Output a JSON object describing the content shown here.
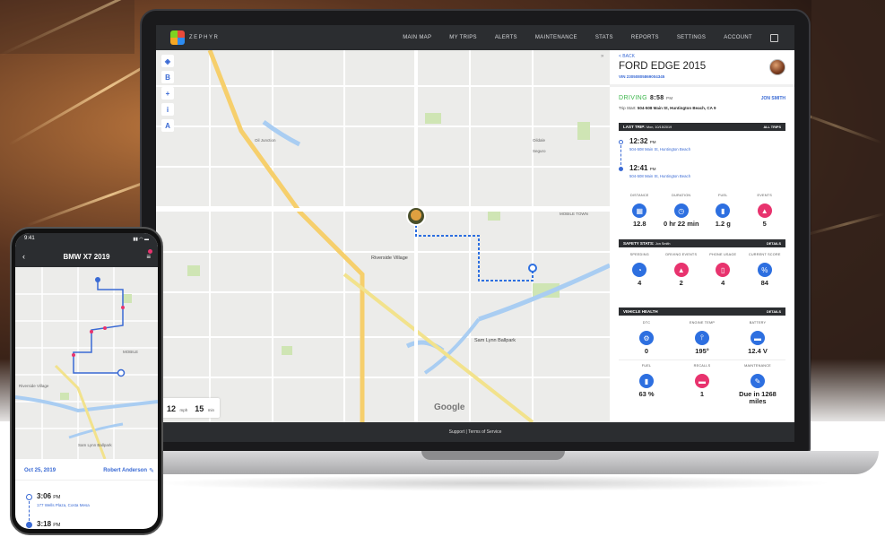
{
  "nav": {
    "logo": "ZEPHYR",
    "items": [
      "MAIN MAP",
      "MY TRIPS",
      "ALERTS",
      "MAINTENANCE",
      "STATS",
      "REPORTS",
      "SETTINGS",
      "ACCOUNT"
    ]
  },
  "map": {
    "tools": [
      "B",
      "+",
      "A"
    ],
    "speed_value": "12",
    "speed_unit": "mph",
    "time_value": "15",
    "time_unit": "min",
    "provider": "Google",
    "labels": {
      "riverside": "Riverside Village",
      "ballpark": "Sam Lynn Ballpark",
      "mobile_town": "MOBILE TOWN",
      "junction": "Oil Junction",
      "oildale": "Oildale",
      "seguro": "Seguro"
    }
  },
  "panel": {
    "back": "< BACK",
    "title": "FORD EDGE 2015",
    "vin": "VIN 23050805869004345",
    "status": "DRIVING",
    "status_time": "8:58",
    "status_ampm": "PM",
    "driver": "JON SMITH",
    "trip_start_label": "Trip Start:",
    "trip_start_addr": "504-508 Main St, Huntington Beach, CA 9",
    "last_trip": {
      "title": "LAST TRIP:",
      "date": "Mon, 10/15/2019",
      "action": "ALL TRIPS",
      "stops": [
        {
          "time": "12:32",
          "ampm": "PM",
          "addr": "504-508 Main St, Huntington Beach"
        },
        {
          "time": "12:41",
          "ampm": "PM",
          "addr": "504-508 Main St, Huntington Beach"
        }
      ]
    },
    "trip_stats": [
      {
        "label": "DISTANCE",
        "value": "12.8",
        "icon": "odometer-icon",
        "glyph": "▦"
      },
      {
        "label": "DURATION",
        "value": "0 hr 22 min",
        "icon": "clock-icon",
        "glyph": "◷"
      },
      {
        "label": "FUEL",
        "value": "1.2 g",
        "icon": "fuel-icon",
        "glyph": "▮"
      },
      {
        "label": "EVENTS",
        "value": "5",
        "icon": "warning-icon",
        "glyph": "▲"
      }
    ],
    "safety": {
      "title": "SAFETY STATS:",
      "driver": "Jon Smith",
      "action": "DETAILS",
      "items": [
        {
          "label": "SPEEDING",
          "value": "4",
          "icon": "speedometer-icon",
          "glyph": "◔"
        },
        {
          "label": "DRIVING EVENTS",
          "value": "2",
          "icon": "warning-icon",
          "glyph": "▲"
        },
        {
          "label": "PHONE USAGE",
          "value": "4",
          "icon": "phone-icon",
          "glyph": "▯"
        },
        {
          "label": "CURRENT SCORE",
          "value": "84",
          "icon": "percent-icon",
          "glyph": "%"
        }
      ]
    },
    "health": {
      "title": "VEHICLE HEALTH",
      "action": "DETAILS",
      "items": [
        {
          "label": "DTC",
          "value": "0",
          "icon": "engine-icon",
          "glyph": "⚙"
        },
        {
          "label": "ENGINE TEMP",
          "value": "195°",
          "icon": "thermometer-icon",
          "glyph": "⫯"
        },
        {
          "label": "BATTERY",
          "value": "12.4 V",
          "icon": "battery-icon",
          "glyph": "▬"
        },
        {
          "label": "FUEL",
          "value": "63 %",
          "icon": "fuel-icon",
          "glyph": "▮"
        },
        {
          "label": "RECALLS",
          "value": "1",
          "icon": "car-icon",
          "glyph": "▬"
        },
        {
          "label": "MAINTENANCE",
          "value": "Due in 1268 miles",
          "icon": "wrench-icon",
          "glyph": "✎"
        }
      ]
    }
  },
  "footer": "Support  |  Terms of Service",
  "phone": {
    "clock": "9:41",
    "status_icons": "▮▮ ◠ ▬",
    "title": "BMW X7 2019",
    "date": "Oct 25, 2019",
    "driver": "Robert Anderson",
    "map_labels": {
      "village": "Riverside Village",
      "ballpark": "Sam Lynn Ballpark",
      "mobile": "MOBILE"
    },
    "stops": [
      {
        "time": "3:06",
        "ampm": "PM",
        "addr": "177 Wells Plaza, Costa Mesa"
      },
      {
        "time": "3:18",
        "ampm": "PM"
      }
    ]
  },
  "colors": {
    "accent": "#2d6fe0",
    "alert": "#e8336e",
    "driving": "#3bb54a",
    "nav": "#2b2d30"
  }
}
